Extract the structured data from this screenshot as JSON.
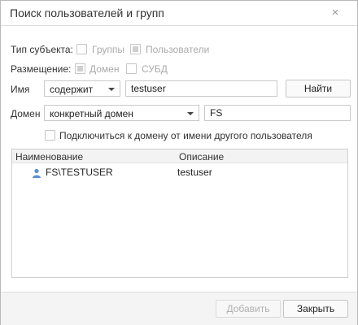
{
  "dialog": {
    "title": "Поиск пользователей и групп",
    "close_glyph": "×"
  },
  "subject_type": {
    "label": "Тип субъекта:",
    "groups_label": "Группы",
    "groups_checked": false,
    "users_label": "Пользователи",
    "users_checked": true
  },
  "placement": {
    "label": "Размещение:",
    "domain_label": "Домен",
    "domain_checked": true,
    "dbms_label": "СУБД",
    "dbms_checked": false
  },
  "name_row": {
    "label": "Имя",
    "condition_value": "содержит",
    "search_value": "testuser",
    "find_button": "Найти"
  },
  "domain_row": {
    "label": "Домен",
    "mode_value": "конкретный домен",
    "domain_value": "FS"
  },
  "connect_other": {
    "label": "Подключиться к домену от имени другого пользователя",
    "checked": false
  },
  "results": {
    "columns": [
      "Наименование",
      "Описание"
    ],
    "rows": [
      {
        "icon": "user-icon",
        "name": "FS\\TESTUSER",
        "description": "testuser"
      }
    ]
  },
  "footer": {
    "add_button": "Добавить",
    "close_button": "Закрыть"
  },
  "colors": {
    "user_icon": "#5b8fd1",
    "disabled_text": "#b0b0b0"
  }
}
